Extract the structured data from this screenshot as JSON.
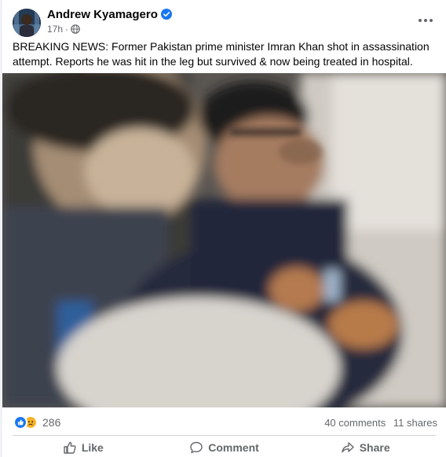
{
  "post": {
    "author": "Andrew Kyamagero",
    "time": "17h",
    "separator": "·",
    "text": "BREAKING NEWS: Former Pakistan prime minister Imran Khan shot in assassination attempt. Reports he was hit in the leg but survived & now being treated in hospital."
  },
  "stats": {
    "reactions_count": "286",
    "comments": "40 comments",
    "shares": "11 shares"
  },
  "actions": {
    "like": "Like",
    "comment": "Comment",
    "share": "Share"
  },
  "icons": {
    "verified": "verified-badge-icon",
    "privacy": "globe-icon",
    "more": "more-options-icon",
    "like_reaction": "like-reaction-icon",
    "sad_reaction": "sad-reaction-icon"
  },
  "colors": {
    "accent": "#1877f2",
    "secondary_text": "#65676b"
  }
}
